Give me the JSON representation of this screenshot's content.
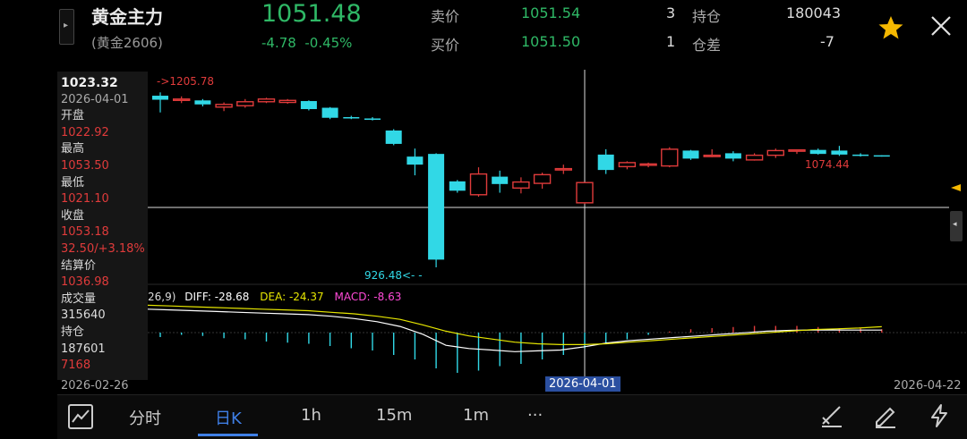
{
  "header": {
    "title": "黄金主力",
    "contract": "(黄金2606)",
    "last_price": "1051.48",
    "change": "-4.78",
    "change_pct": "-0.45%",
    "ask_label": "卖价",
    "ask_price": "1051.54",
    "ask_qty": "3",
    "bid_label": "买价",
    "bid_price": "1051.50",
    "bid_qty": "1",
    "oi_label": "持仓",
    "oi_value": "180043",
    "oi_diff_label": "仓差",
    "oi_diff_value": "-7"
  },
  "panel": {
    "price": "1023.32",
    "date": "2026-04-01",
    "open_label": "开盘",
    "open": "1022.92",
    "high_label": "最高",
    "high": "1053.50",
    "low_label": "最低",
    "low": "1021.10",
    "close_label": "收盘",
    "close": "1053.18",
    "close_chg": "32.50/+3.18%",
    "settle_label": "结算价",
    "settle": "1036.98",
    "volume_label": "成交量",
    "volume": "315640",
    "oi_label": "持仓",
    "oi": "187601",
    "oi_diff": "7168"
  },
  "chart": {
    "max_label": "->1205.78",
    "min_label": "926.48<- -",
    "local_high_label": "1074.44",
    "macd_params": "26,9)",
    "diff_label": "DIFF: -28.68",
    "dea_label": "DEA: -24.37",
    "macd_label": "MACD: -8.63",
    "date_start": "2026-02-26",
    "date_cursor": "2026-04-01",
    "date_end": "2026-04-22"
  },
  "colors": {
    "up": "#e03b3b",
    "down": "#31d8e6",
    "price_green": "#2fb866",
    "diff_line": "#ffffff",
    "dea_line": "#e6e600",
    "macd_label": "#ff4ad8",
    "accent": "#3f7fe6",
    "star": "#f5b800"
  },
  "chart_data": {
    "type": "candlestick",
    "candles": [
      {
        "o": 1183,
        "h": 1188,
        "l": 1158,
        "c": 1177
      },
      {
        "o": 1177,
        "h": 1182,
        "l": 1172,
        "c": 1178
      },
      {
        "o": 1176,
        "h": 1178,
        "l": 1167,
        "c": 1170
      },
      {
        "o": 1166,
        "h": 1173,
        "l": 1160,
        "c": 1170
      },
      {
        "o": 1168,
        "h": 1178,
        "l": 1165,
        "c": 1174
      },
      {
        "o": 1174,
        "h": 1180,
        "l": 1172,
        "c": 1178
      },
      {
        "o": 1173,
        "h": 1178,
        "l": 1171,
        "c": 1176
      },
      {
        "o": 1175,
        "h": 1176,
        "l": 1161,
        "c": 1163
      },
      {
        "o": 1165,
        "h": 1166,
        "l": 1148,
        "c": 1150
      },
      {
        "o": 1151,
        "h": 1153,
        "l": 1148,
        "c": 1149
      },
      {
        "o": 1149,
        "h": 1151,
        "l": 1146,
        "c": 1148
      },
      {
        "o": 1131,
        "h": 1133,
        "l": 1109,
        "c": 1111
      },
      {
        "o": 1092,
        "h": 1104,
        "l": 1064,
        "c": 1080
      },
      {
        "o": 1096,
        "h": 1097,
        "l": 926.48,
        "c": 938
      },
      {
        "o": 1055,
        "h": 1057,
        "l": 1038,
        "c": 1041
      },
      {
        "o": 1035,
        "h": 1076,
        "l": 1032,
        "c": 1066
      },
      {
        "o": 1062,
        "h": 1071,
        "l": 1038,
        "c": 1051
      },
      {
        "o": 1045,
        "h": 1061,
        "l": 1037,
        "c": 1054
      },
      {
        "o": 1052,
        "h": 1068,
        "l": 1044,
        "c": 1065
      },
      {
        "o": 1073,
        "h": 1080,
        "l": 1066,
        "c": 1074
      },
      {
        "o": 1022.92,
        "h": 1053.5,
        "l": 1021.1,
        "c": 1053.18
      },
      {
        "o": 1095,
        "h": 1103,
        "l": 1066,
        "c": 1072
      },
      {
        "o": 1077,
        "h": 1085,
        "l": 1073,
        "c": 1083
      },
      {
        "o": 1080,
        "h": 1083,
        "l": 1076,
        "c": 1081
      },
      {
        "o": 1078,
        "h": 1106,
        "l": 1076,
        "c": 1103
      },
      {
        "o": 1101,
        "h": 1102,
        "l": 1087,
        "c": 1089
      },
      {
        "o": 1094,
        "h": 1103,
        "l": 1091,
        "c": 1094
      },
      {
        "o": 1097,
        "h": 1100,
        "l": 1085,
        "c": 1089
      },
      {
        "o": 1087,
        "h": 1097,
        "l": 1086,
        "c": 1094
      },
      {
        "o": 1094,
        "h": 1104,
        "l": 1090,
        "c": 1101
      },
      {
        "o": 1100,
        "h": 1101,
        "l": 1096,
        "c": 1102
      },
      {
        "o": 1102,
        "h": 1104,
        "l": 1095,
        "c": 1096
      },
      {
        "o": 1101,
        "h": 1108,
        "l": 1093,
        "c": 1095
      },
      {
        "o": 1095,
        "h": 1097,
        "l": 1092,
        "c": 1094
      },
      {
        "o": 1094,
        "h": 1094,
        "l": 1092,
        "c": 1093
      }
    ],
    "macd_hist": [
      -4,
      -2,
      -3,
      -5,
      -6,
      -8,
      -9,
      -10,
      -12,
      -14,
      -16,
      -20,
      -24,
      -32,
      -36,
      -34,
      -30,
      -28,
      -24,
      -20,
      -14,
      -10,
      -6,
      -2,
      1,
      3,
      4,
      5,
      6,
      6,
      6,
      5,
      4,
      4,
      3
    ],
    "diff": [
      -2,
      -3,
      -4,
      -5,
      -6,
      -7,
      -8,
      -9,
      -11,
      -14,
      -18,
      -24,
      -34,
      -48,
      -52,
      -54,
      -56,
      -55,
      -54,
      -50,
      -45,
      -42,
      -40,
      -38,
      -36,
      -34,
      -32,
      -30,
      -29,
      -28.5,
      -28.5,
      -28.6,
      -28.68
    ],
    "dea": [
      3,
      2,
      1,
      0,
      -1,
      -2,
      -3,
      -4,
      -6,
      -8,
      -11,
      -15,
      -22,
      -30,
      -36,
      -40,
      -44,
      -46,
      -47,
      -47,
      -46,
      -44,
      -42,
      -40,
      -38,
      -36,
      -34,
      -32,
      -30,
      -28,
      -27,
      -26,
      -24.37
    ]
  }
}
